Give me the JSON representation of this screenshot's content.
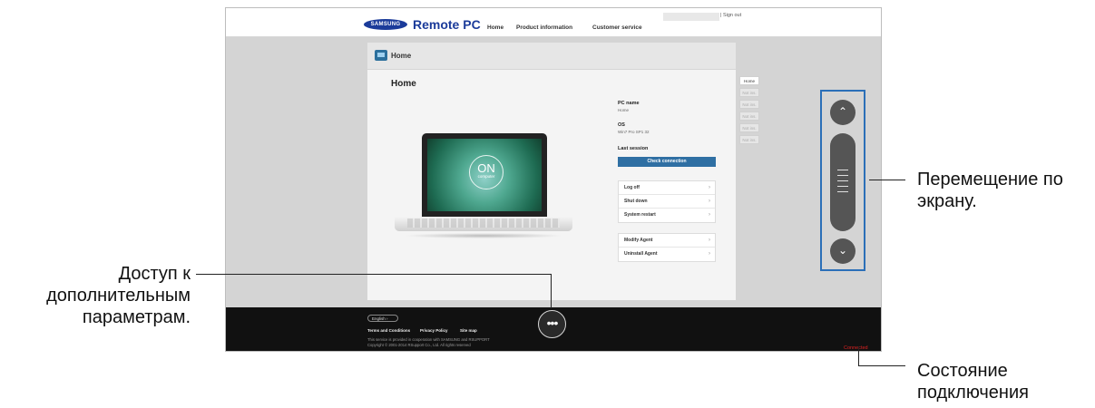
{
  "header": {
    "logo_text": "SAMSUNG",
    "app_title": "Remote PC",
    "nav": [
      "Home",
      "Product information",
      "Customer service"
    ],
    "signout": "| Sign out"
  },
  "panel": {
    "header_label": "Home",
    "title": "Home",
    "laptop": {
      "status_big": "ON",
      "status_small": "computer"
    },
    "info": {
      "pc_name_label": "PC name",
      "pc_name_value": "Home",
      "os_label": "OS",
      "os_value": "Win7 Pro SP1 32",
      "last_session_label": "Last session"
    },
    "check_connection": "Check connection",
    "actions": [
      "Log off",
      "Shut down",
      "System restart"
    ],
    "agent_actions": [
      "Modify Agent",
      "Uninstall Agent"
    ]
  },
  "right_tabs": [
    "Home",
    "Not ins.",
    "Not ins.",
    "Not ins.",
    "Not ins.",
    "Not ins."
  ],
  "footer": {
    "language": "English",
    "links": [
      "Terms and Conditions",
      "Privacy Policy",
      "Site map"
    ],
    "notice1": "This service is provided in cooperation with SAMSUNG and RSUPPORT",
    "notice2": "Copyright © 2001-2014 RSupport Co., Ltd. All rights reserved",
    "more_symbol": "•••",
    "status": "Connected"
  },
  "annotations": {
    "scroll": "Перемещение по экрану.",
    "more_options": "Доступ к дополнительным параметрам.",
    "connection_status": "Состояние подключения"
  },
  "colors": {
    "brand_blue": "#1b3b9a",
    "button_blue": "#2f6fa3",
    "highlight_frame": "#2b6fb8",
    "status_red": "#dd2222"
  },
  "icons": [
    "home-icon",
    "chevron-up-icon",
    "chevron-down-icon",
    "grip-icon",
    "more-dots-icon"
  ]
}
